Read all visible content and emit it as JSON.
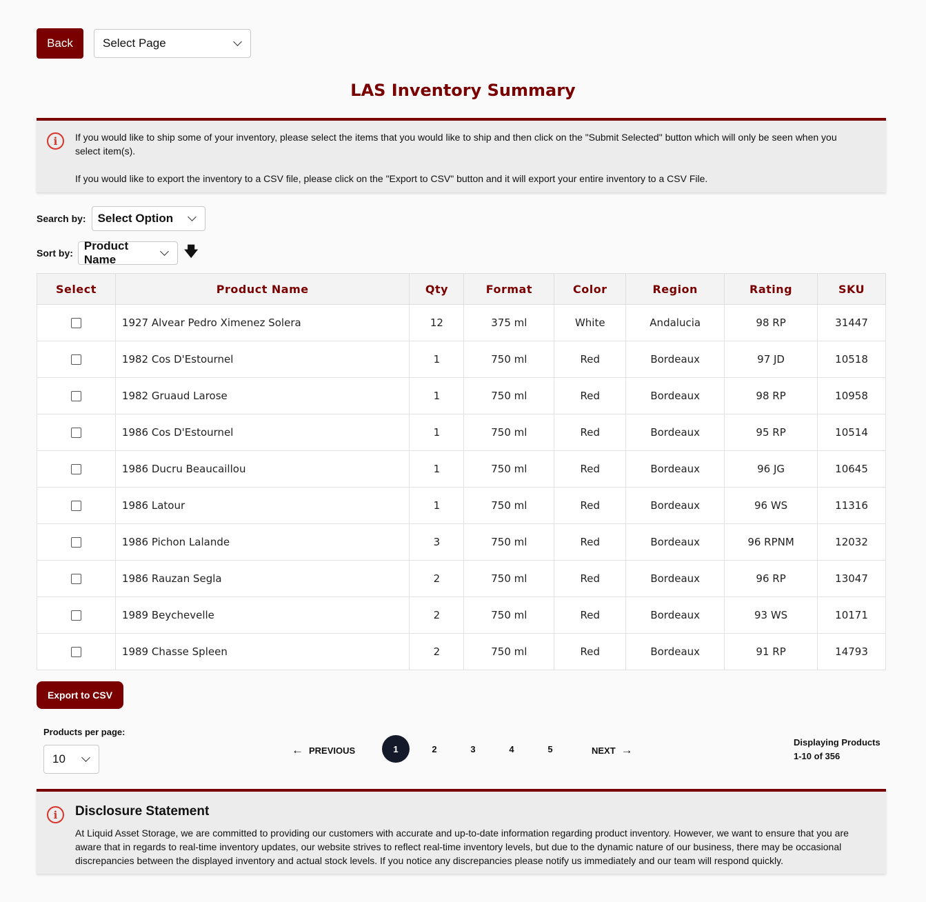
{
  "toolbar": {
    "back_label": "Back",
    "page_select_value": "Select Page"
  },
  "title": "LAS Inventory Summary",
  "info": {
    "line1": "If you would like to ship some of your inventory, please select the items that you would like to ship and then click on the \"Submit Selected\" button which will only be seen when you select item(s).",
    "line2": "If you would like to export the inventory to a CSV file, please click on the \"Export to CSV\" button and it will export your entire inventory to a CSV File."
  },
  "search": {
    "label": "Search by:",
    "value": "Select Option"
  },
  "sort": {
    "label": "Sort by:",
    "value": "Product Name",
    "direction_icon": "arrow-down-icon"
  },
  "table": {
    "headers": [
      "Select",
      "Product Name",
      "Qty",
      "Format",
      "Color",
      "Region",
      "Rating",
      "SKU"
    ],
    "rows": [
      {
        "name": "1927 Alvear Pedro Ximenez Solera",
        "qty": "12",
        "format": "375 ml",
        "color": "White",
        "region": "Andalucia",
        "rating": "98 RP",
        "sku": "31447"
      },
      {
        "name": "1982 Cos D'Estournel",
        "qty": "1",
        "format": "750 ml",
        "color": "Red",
        "region": "Bordeaux",
        "rating": "97 JD",
        "sku": "10518"
      },
      {
        "name": "1982 Gruaud Larose",
        "qty": "1",
        "format": "750 ml",
        "color": "Red",
        "region": "Bordeaux",
        "rating": "98 RP",
        "sku": "10958"
      },
      {
        "name": "1986 Cos D'Estournel",
        "qty": "1",
        "format": "750 ml",
        "color": "Red",
        "region": "Bordeaux",
        "rating": "95 RP",
        "sku": "10514"
      },
      {
        "name": "1986 Ducru Beaucaillou",
        "qty": "1",
        "format": "750 ml",
        "color": "Red",
        "region": "Bordeaux",
        "rating": "96 JG",
        "sku": "10645"
      },
      {
        "name": "1986 Latour",
        "qty": "1",
        "format": "750 ml",
        "color": "Red",
        "region": "Bordeaux",
        "rating": "96 WS",
        "sku": "11316"
      },
      {
        "name": "1986 Pichon Lalande",
        "qty": "3",
        "format": "750 ml",
        "color": "Red",
        "region": "Bordeaux",
        "rating": "96 RPNM",
        "sku": "12032"
      },
      {
        "name": "1986 Rauzan Segla",
        "qty": "2",
        "format": "750 ml",
        "color": "Red",
        "region": "Bordeaux",
        "rating": "96 RP",
        "sku": "13047"
      },
      {
        "name": "1989 Beychevelle",
        "qty": "2",
        "format": "750 ml",
        "color": "Red",
        "region": "Bordeaux",
        "rating": "93 WS",
        "sku": "10171"
      },
      {
        "name": "1989 Chasse Spleen",
        "qty": "2",
        "format": "750 ml",
        "color": "Red",
        "region": "Bordeaux",
        "rating": "91 RP",
        "sku": "14793"
      }
    ]
  },
  "export_label": "Export to CSV",
  "per_page": {
    "label": "Products per page:",
    "value": "10"
  },
  "pagination": {
    "previous": "PREVIOUS",
    "next": "NEXT",
    "pages": [
      "1",
      "2",
      "3",
      "4",
      "5"
    ],
    "current": "1"
  },
  "display": {
    "line1": "Displaying Products",
    "line2": "1-10 of 356"
  },
  "disclosure": {
    "title": "Disclosure Statement",
    "body": "At Liquid Asset Storage, we are committed to providing our customers with accurate and up-to-date information regarding product inventory. However, we want to ensure that you are aware that in regards to real-time inventory updates, our website strives to reflect real-time inventory levels, but due to the dynamic nature of our business, there may be occasional discrepancies between the displayed inventory and actual stock levels. If you notice any discrepancies please notify us immediately and our team will respond quickly."
  },
  "colors": {
    "brand": "#7a0000",
    "pager_active": "#141a2a",
    "info_icon": "#d9342b"
  }
}
